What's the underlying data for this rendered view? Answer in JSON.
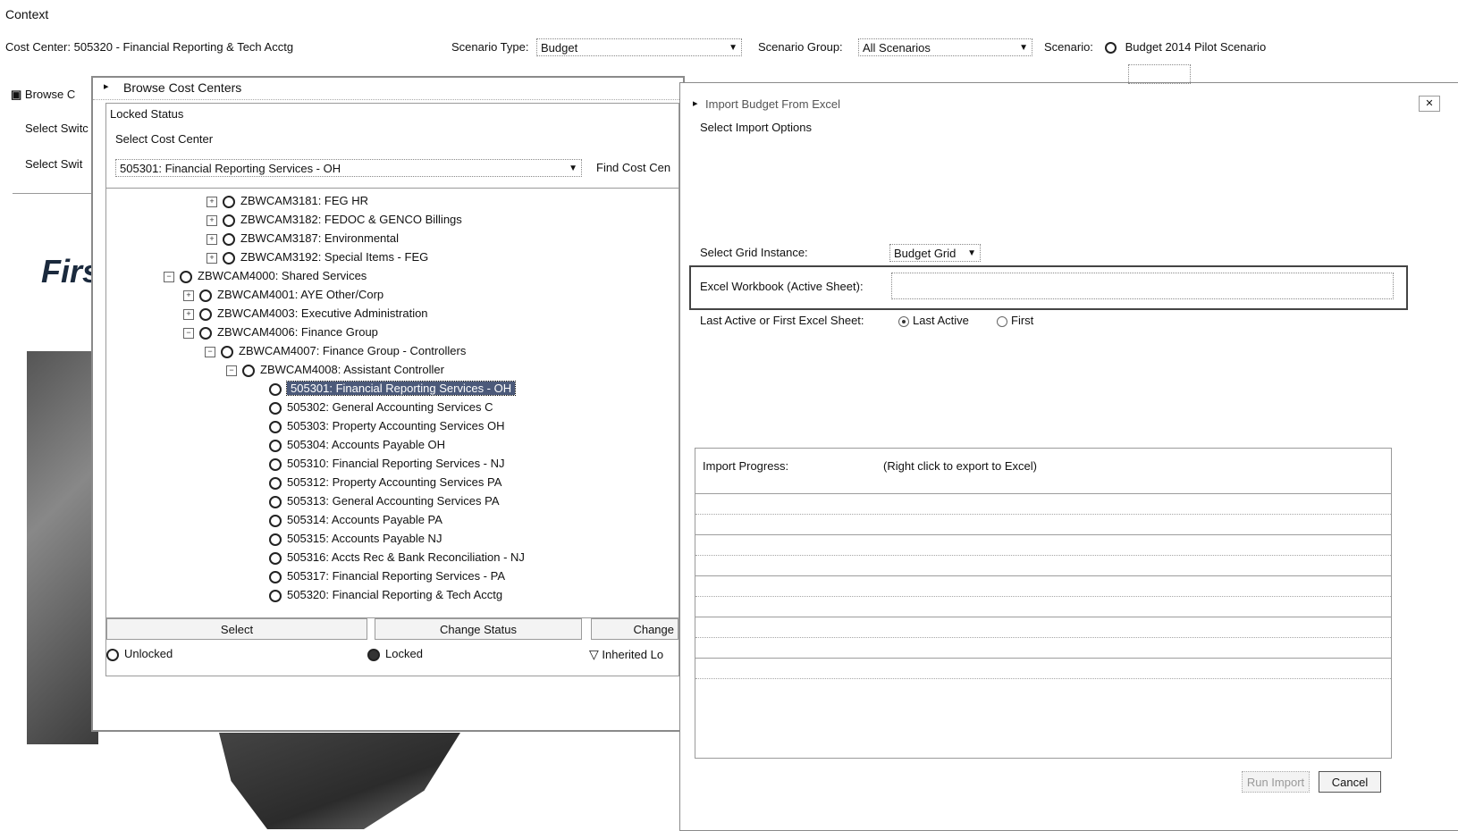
{
  "context": {
    "label": "Context",
    "cost_center_label": "Cost Center:",
    "cost_center_value": "505320 - Financial Reporting & Tech Acctg",
    "scenario_type_label": "Scenario Type:",
    "scenario_type_value": "Budget",
    "scenario_group_label": "Scenario Group:",
    "scenario_group_value": "All Scenarios",
    "scenario_label": "Scenario:",
    "scenario_value": "Budget 2014 Pilot Scenario"
  },
  "background_panel": {
    "browse_label": "Browse C",
    "select_switch_1": "Select Switc",
    "select_switch_2": "Select Swit",
    "brand_fragment": "Firs"
  },
  "browse_dialog": {
    "title": "Browse Cost Centers",
    "locked_status_label": "Locked Status",
    "select_cost_center_label": "Select Cost Center",
    "select_cost_center_value": "505301: Financial Reporting Services - OH",
    "find_cost_center_label": "Find Cost Cen",
    "tree": [
      {
        "label": "ZBWCAM3181: FEG HR"
      },
      {
        "label": "ZBWCAM3182: FEDOC & GENCO Billings"
      },
      {
        "label": "ZBWCAM3187: Environmental"
      },
      {
        "label": "ZBWCAM3192: Special Items - FEG"
      },
      {
        "label": "ZBWCAM4000: Shared Services"
      },
      {
        "label": "ZBWCAM4001: AYE Other/Corp"
      },
      {
        "label": "ZBWCAM4003: Executive Administration"
      },
      {
        "label": "ZBWCAM4006: Finance Group"
      },
      {
        "label": "ZBWCAM4007: Finance Group - Controllers"
      },
      {
        "label": "ZBWCAM4008: Assistant Controller"
      },
      {
        "label": "505301: Financial Reporting Services - OH"
      },
      {
        "label": "505302: General Accounting Services C"
      },
      {
        "label": "505303: Property Accounting Services OH"
      },
      {
        "label": "505304: Accounts Payable OH"
      },
      {
        "label": "505310: Financial Reporting Services - NJ"
      },
      {
        "label": "505312: Property Accounting Services PA"
      },
      {
        "label": "505313: General Accounting Services PA"
      },
      {
        "label": "505314: Accounts Payable PA"
      },
      {
        "label": "505315: Accounts Payable NJ"
      },
      {
        "label": "505316: Accts Rec & Bank Reconciliation - NJ"
      },
      {
        "label": "505317: Financial Reporting Services - PA"
      },
      {
        "label": "505320: Financial Reporting & Tech Acctg"
      }
    ],
    "buttons": {
      "select": "Select",
      "change_status": "Change Status",
      "change": "Change"
    },
    "legend": {
      "unlocked": "Unlocked",
      "locked": "Locked",
      "inherited": "Inherited Lo"
    }
  },
  "import_dialog": {
    "title": "Import Budget From Excel",
    "subtitle": "Select Import Options",
    "grid_instance_label": "Select Grid Instance:",
    "grid_instance_value": "Budget Grid",
    "workbook_label": "Excel Workbook (Active Sheet):",
    "workbook_value": "",
    "sheet_label": "Last Active or First Excel Sheet:",
    "sheet_options": [
      "Last Active",
      "First"
    ],
    "sheet_selected": "Last Active",
    "progress_label": "Import Progress:",
    "progress_hint": "(Right click to export to Excel)",
    "buttons": {
      "run_import": "Run Import",
      "cancel": "Cancel"
    }
  }
}
